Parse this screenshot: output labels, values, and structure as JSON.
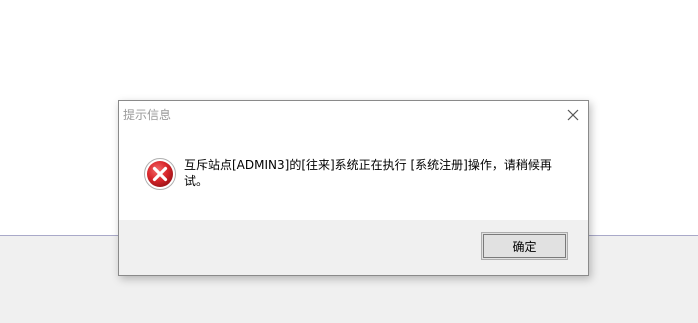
{
  "dialog": {
    "title": "提示信息",
    "message": "互斥站点[ADMIN3]的[往来]系统正在执行 [系统注册]操作，请稍候再试。",
    "icon": "error-icon",
    "ok_label": "确定",
    "close_icon": "close-icon"
  },
  "colors": {
    "error_red": "#d9262b",
    "title_gray": "#9a9a9a",
    "footer_bg": "#f0f0f0",
    "button_bg": "#e1e1e1"
  }
}
